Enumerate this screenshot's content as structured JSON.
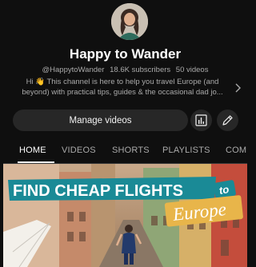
{
  "channel": {
    "name": "Happy to Wander",
    "handle": "@HappytoWander",
    "subscribers": "18.6K subscribers",
    "videos": "50 videos",
    "description_line1": "Hi 👋 This channel is here to help you travel Europe (and",
    "description_line2": "beyond) with practical tips, guides & the occasional dad jo..."
  },
  "actions": {
    "manage_label": "Manage videos"
  },
  "tabs": [
    {
      "label": "HOME",
      "active": true
    },
    {
      "label": "VIDEOS",
      "active": false
    },
    {
      "label": "SHORTS",
      "active": false
    },
    {
      "label": "PLAYLISTS",
      "active": false
    },
    {
      "label": "COMMUNITY",
      "active": false
    }
  ],
  "featured": {
    "headline": "FIND CHEAP FLIGHTS",
    "to": "to",
    "destination": "Europe"
  },
  "icons": {
    "analytics": "analytics-icon",
    "edit": "pencil-icon",
    "chevron": "chevron-right-icon"
  },
  "colors": {
    "background": "#0f0f0f",
    "button": "#272727",
    "banner": "#1a8a96",
    "accent": "#e8b54a"
  }
}
